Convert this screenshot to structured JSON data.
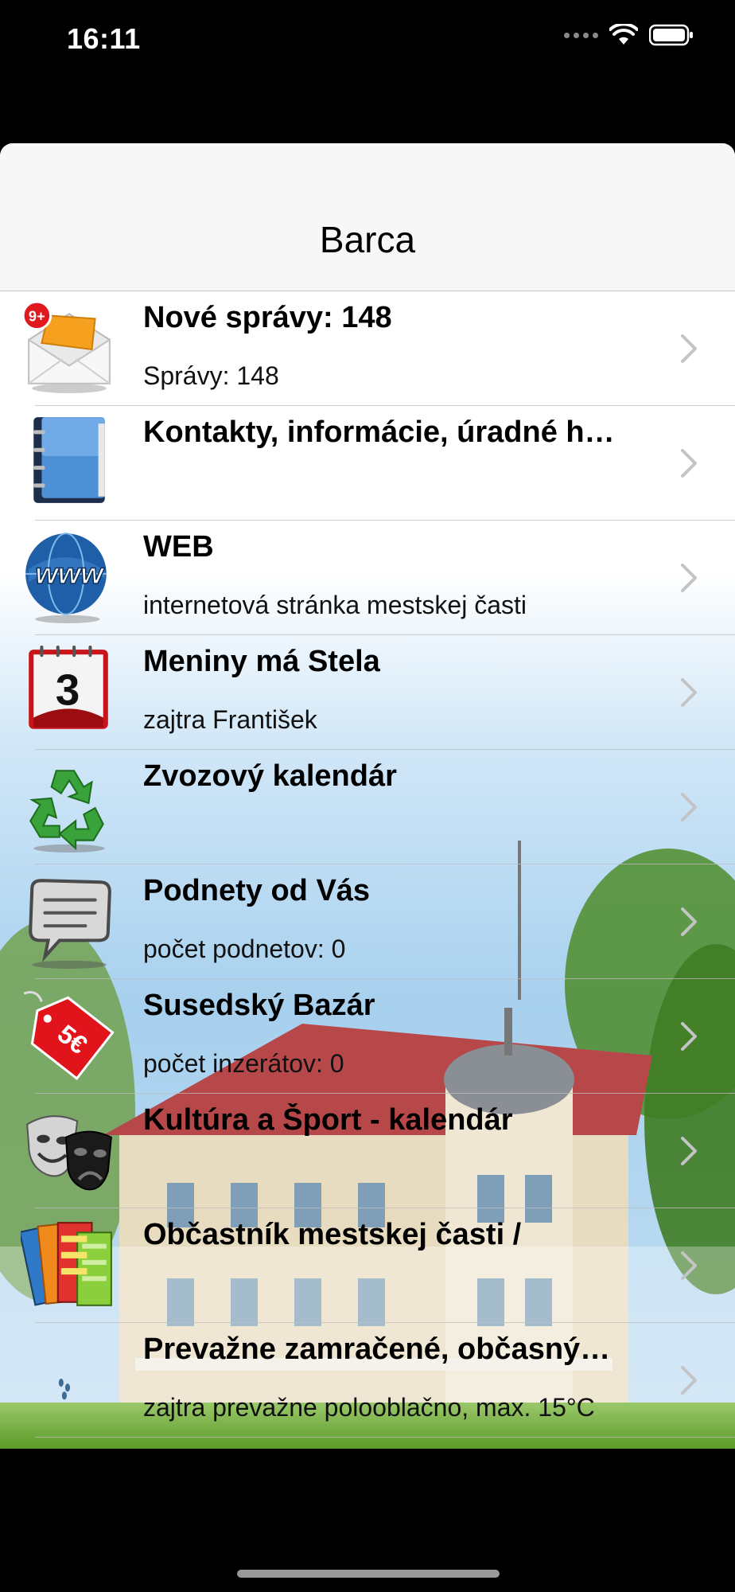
{
  "status": {
    "time": "16:11"
  },
  "nav": {
    "title": "Barca"
  },
  "rows": [
    {
      "icon": "envelope-icon",
      "badge": "9+",
      "title": "Nové správy: 148",
      "subtitle": "Správy: 148"
    },
    {
      "icon": "address-book-icon",
      "title": "Kontakty, informácie, úradné h…",
      "subtitle": ""
    },
    {
      "icon": "globe-www-icon",
      "title": "WEB",
      "subtitle": "internetová stránka mestskej časti"
    },
    {
      "icon": "calendar-icon",
      "calendar_day": "3",
      "title": "Meniny má Stela",
      "subtitle": "zajtra František"
    },
    {
      "icon": "recycle-icon",
      "title": "Zvozový kalendár",
      "subtitle": ""
    },
    {
      "icon": "speech-bubble-icon",
      "title": "Podnety od Vás",
      "subtitle": "počet podnetov: 0"
    },
    {
      "icon": "price-tag-icon",
      "tag_text": "5€",
      "title": "Susedský Bazár",
      "subtitle": "počet inzerátov: 0"
    },
    {
      "icon": "theater-masks-icon",
      "title": "Kultúra a Šport - kalendár",
      "subtitle": ""
    },
    {
      "icon": "magazines-icon",
      "title": "Občastník mestskej časti /",
      "subtitle": ""
    },
    {
      "icon": "weather-rain-icon",
      "title": "Prevažne zamračené, občasný…",
      "subtitle": "zajtra prevažne polooblačno, max. 15°C"
    }
  ],
  "colors": {
    "sky": "#a9d3ef",
    "grass": "#6aa830",
    "nav_bg": "#f7f7f7",
    "badge": "#e0191f",
    "chevron": "#c4c4c7"
  }
}
